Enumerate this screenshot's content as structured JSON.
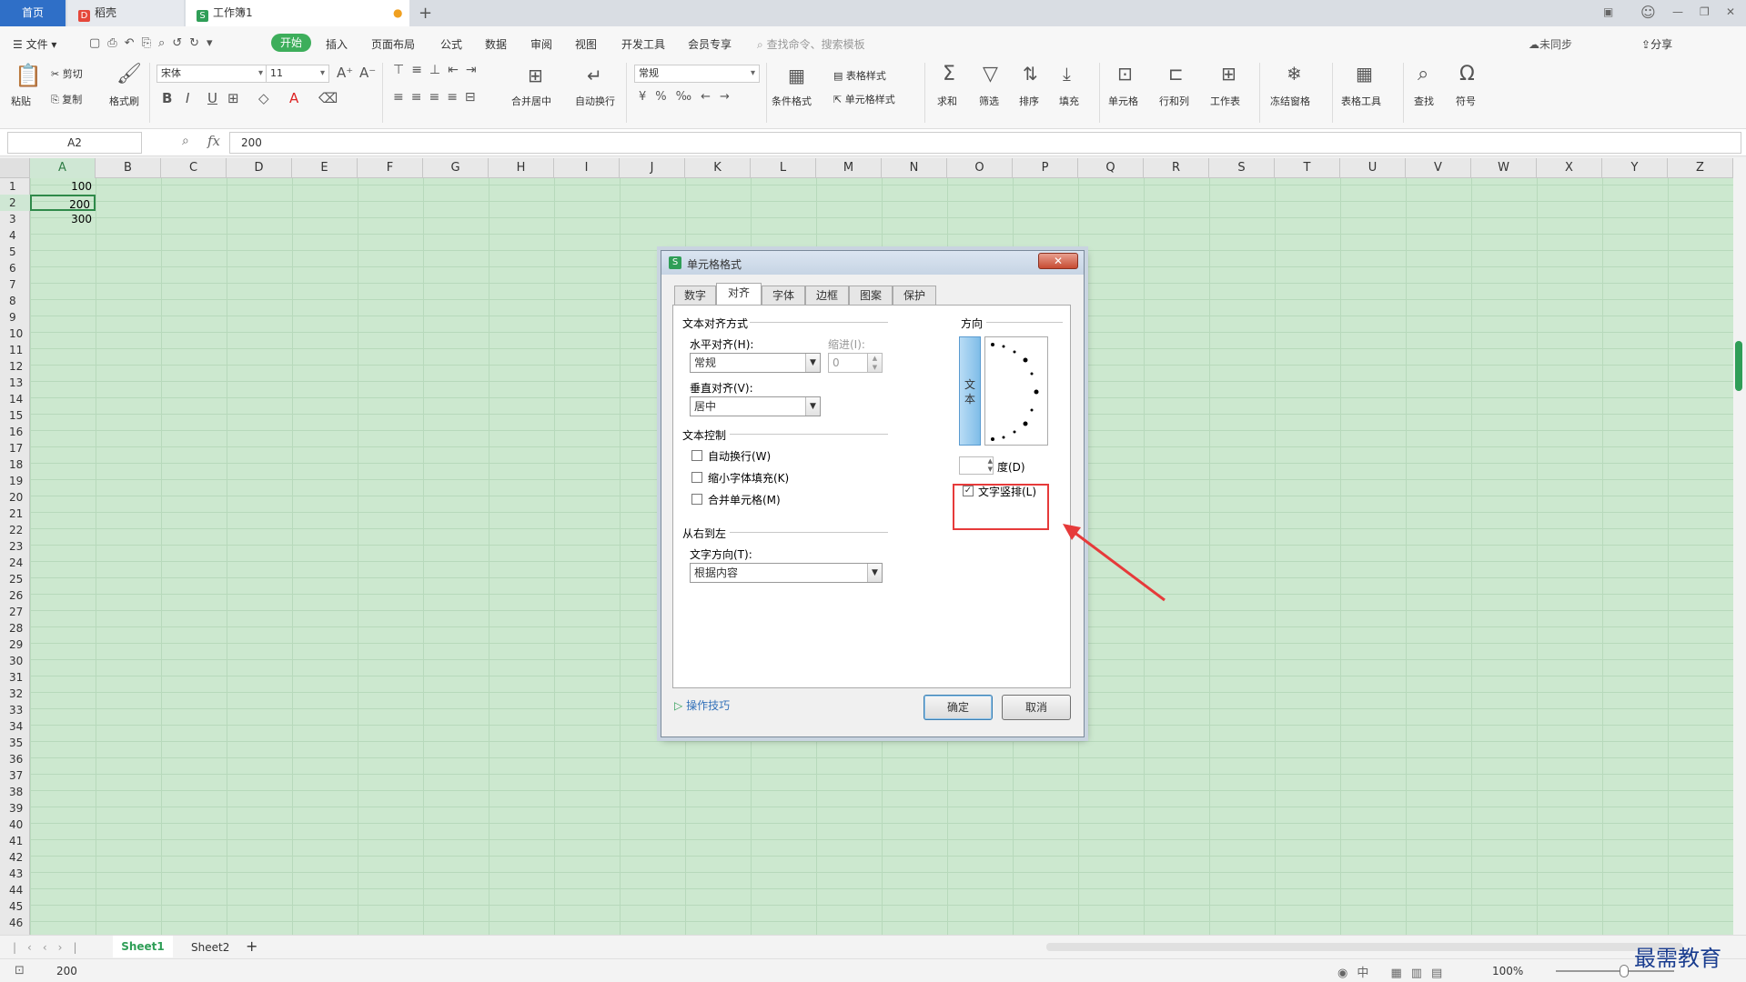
{
  "tabs": {
    "home": "首页",
    "daoke": "稻壳",
    "book": "工作簿1",
    "new_tab": "+"
  },
  "menu": {
    "file": "文件",
    "items": [
      "开始",
      "插入",
      "页面布局",
      "公式",
      "数据",
      "审阅",
      "视图",
      "开发工具",
      "会员专享"
    ],
    "search_placeholder": "查找命令、搜索模板",
    "share": "分享",
    "sync": "未同步"
  },
  "ribbon": {
    "paste": "粘贴",
    "cut": "剪切",
    "copy": "复制",
    "format_painter": "格式刷",
    "font_name": "宋体",
    "font_size": "11",
    "merge_center": "合并居中",
    "wrap": "自动换行",
    "number_format": "常规",
    "cond_format": "条件格式",
    "table_style": "表格样式",
    "cell_style": "单元格样式",
    "sum": "求和",
    "filter": "筛选",
    "sort": "排序",
    "fill": "填充",
    "cell": "单元格",
    "row_col": "行和列",
    "worksheet": "工作表",
    "freeze": "冻结窗格",
    "table_tools": "表格工具",
    "find": "查找",
    "symbol": "符号"
  },
  "formula_bar": {
    "name_box": "A2",
    "value": "200"
  },
  "columns": [
    "A",
    "B",
    "C",
    "D",
    "E",
    "F",
    "G",
    "H",
    "I",
    "J",
    "K",
    "L",
    "M",
    "N",
    "O",
    "P",
    "Q",
    "R",
    "S",
    "T",
    "U",
    "V",
    "W",
    "X",
    "Y",
    "Z"
  ],
  "rows": [
    "1",
    "2",
    "3",
    "4",
    "5",
    "6",
    "7",
    "8",
    "9",
    "10",
    "11",
    "12",
    "13",
    "14",
    "15",
    "16",
    "17",
    "18",
    "19",
    "20",
    "21",
    "22",
    "23",
    "24",
    "25",
    "26",
    "27",
    "28",
    "29",
    "30",
    "31",
    "32",
    "33",
    "34",
    "35",
    "36",
    "37",
    "38",
    "39",
    "40",
    "41",
    "42",
    "43",
    "44",
    "45",
    "46"
  ],
  "cells": {
    "a1": "100",
    "a2": "200",
    "a3": "300"
  },
  "sheets": {
    "s1": "Sheet1",
    "s2": "Sheet2",
    "add": "+"
  },
  "status": {
    "value": "200",
    "zoom": "100%"
  },
  "watermark": "最需教育",
  "dialog": {
    "title": "单元格格式",
    "tabs": [
      "数字",
      "对齐",
      "字体",
      "边框",
      "图案",
      "保护"
    ],
    "align_group": "文本对齐方式",
    "h_align_label": "水平对齐(H):",
    "h_align_value": "常规",
    "indent_label": "缩进(I):",
    "indent_value": "0",
    "v_align_label": "垂直对齐(V):",
    "v_align_value": "居中",
    "control_group": "文本控制",
    "wrap_text": "自动换行(W)",
    "shrink_fit": "缩小字体填充(K)",
    "merge_cells": "合并单元格(M)",
    "rtl_group": "从右到左",
    "text_dir_label": "文字方向(T):",
    "text_dir_value": "根据内容",
    "orientation_group": "方向",
    "vertical_text": "文本",
    "degree_label": "度(D)",
    "vertical_checkbox": "文字竖排(L)",
    "tips": "操作技巧",
    "ok": "确定",
    "cancel": "取消"
  },
  "colors": {
    "accent": "#2f9e57",
    "grid_bg": "#cce8cf",
    "highlight": "#e63a3a"
  }
}
